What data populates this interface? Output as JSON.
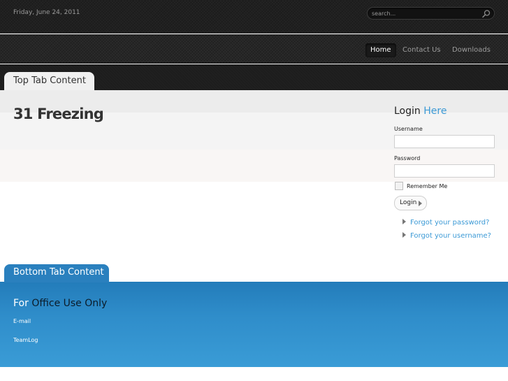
{
  "header": {
    "date": "Friday, June 24, 2011",
    "search_placeholder": "search..."
  },
  "nav": {
    "items": [
      {
        "label": "Home",
        "active": true
      },
      {
        "label": "Contact Us",
        "active": false
      },
      {
        "label": "Downloads",
        "active": false
      }
    ]
  },
  "top_tab": {
    "label": "Top Tab Content"
  },
  "main": {
    "title": "31 Freezing"
  },
  "login": {
    "heading_prefix": "Login",
    "heading_accent": "Here",
    "username_label": "Username",
    "username_value": "",
    "password_label": "Password",
    "password_value": "",
    "remember_label": "Remember Me",
    "remember_checked": false,
    "button_label": "Login",
    "links": [
      {
        "label": "Forgot your password?"
      },
      {
        "label": "Forgot your username?"
      }
    ]
  },
  "bottom_tab": {
    "label": "Bottom Tab Content"
  },
  "office": {
    "title_prefix": "For",
    "title_rest": "Office Use Only",
    "items": [
      {
        "label": "E-mail"
      },
      {
        "label": "TeamLog"
      }
    ]
  },
  "colors": {
    "accent_blue": "#3c9ad6",
    "bottom_band": "#2f8dca",
    "header_dark": "#202020"
  }
}
